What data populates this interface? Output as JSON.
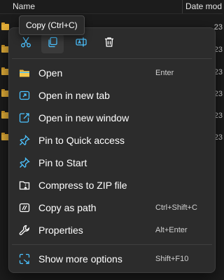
{
  "explorer": {
    "columns": {
      "name": "Name",
      "date_modified": "Date mod"
    },
    "rows": [
      {
        "date": "23"
      },
      {
        "date": "23"
      },
      {
        "date": "23"
      },
      {
        "date": "23"
      },
      {
        "date": "23"
      },
      {
        "date": "23"
      }
    ]
  },
  "tooltip": {
    "text": "Copy (Ctrl+C)"
  },
  "context_menu": {
    "quick_actions": [
      {
        "name": "cut",
        "icon": "scissors-icon"
      },
      {
        "name": "copy",
        "icon": "copy-icon"
      },
      {
        "name": "rename",
        "icon": "rename-icon"
      },
      {
        "name": "delete",
        "icon": "trash-icon"
      }
    ],
    "items": [
      {
        "label": "Open",
        "shortcut": "Enter",
        "icon": "folder-open-icon"
      },
      {
        "label": "Open in new tab",
        "shortcut": "",
        "icon": "new-tab-icon"
      },
      {
        "label": "Open in new window",
        "shortcut": "",
        "icon": "new-window-icon"
      },
      {
        "label": "Pin to Quick access",
        "shortcut": "",
        "icon": "pin-icon"
      },
      {
        "label": "Pin to Start",
        "shortcut": "",
        "icon": "pin-icon"
      },
      {
        "label": "Compress to ZIP file",
        "shortcut": "",
        "icon": "zip-folder-icon"
      },
      {
        "label": "Copy as path",
        "shortcut": "Ctrl+Shift+C",
        "icon": "copy-path-icon"
      },
      {
        "label": "Properties",
        "shortcut": "Alt+Enter",
        "icon": "wrench-icon"
      }
    ],
    "more": {
      "label": "Show more options",
      "shortcut": "Shift+F10",
      "icon": "show-more-icon"
    }
  },
  "colors": {
    "accent": "#4cc2ff",
    "folder": "#e8b23a",
    "menu_bg": "#2c2c2c",
    "page_bg": "#1c1c1c"
  }
}
